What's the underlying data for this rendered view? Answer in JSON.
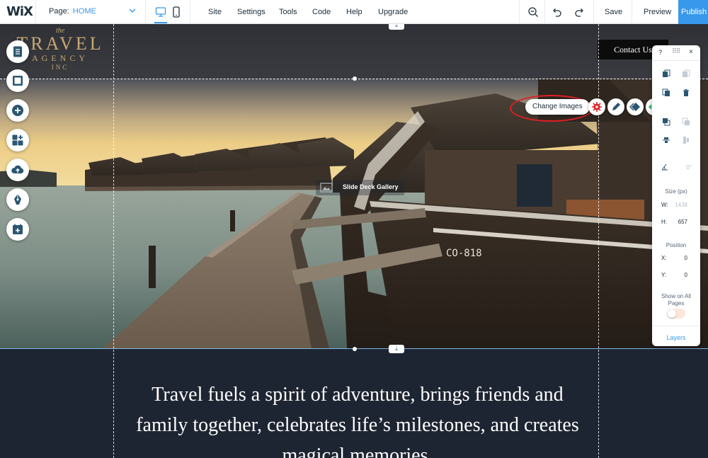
{
  "topbar": {
    "logo": "WiX",
    "page_label": "Page:",
    "page_name": "HOME",
    "menu": [
      "Site",
      "Settings",
      "Tools",
      "Code",
      "Help",
      "Upgrade"
    ],
    "save": "Save",
    "preview": "Preview",
    "publish": "Publish",
    "accent": "#3899ec"
  },
  "site": {
    "brand_the": "the",
    "brand_name": "TRAVEL",
    "brand_agency": "AGENCY",
    "brand_inc": "INC",
    "contact_button": "Contact Us",
    "boat_number": "CO-818",
    "quote": "Travel fuels a spirit of adventure, brings friends and family together, celebrates life’s milestones, and creates magical memories."
  },
  "gallery": {
    "label": "Slide Deck Gallery",
    "change_images": "Change Images",
    "tools": [
      "settings-icon",
      "design-pen-icon",
      "animation-icon",
      "stretch-icon",
      "help-icon"
    ]
  },
  "left_tools": [
    "pages-icon",
    "background-icon",
    "add-icon",
    "app-market-icon",
    "media-upload-icon",
    "blog-pen-icon",
    "bookings-icon"
  ],
  "panel": {
    "help": "?",
    "close": "×",
    "rotation": "0°",
    "size_title": "Size (px)",
    "w_label": "W:",
    "w_value": "1438",
    "h_label": "H:",
    "h_value": "657",
    "position_title": "Position",
    "x_label": "X:",
    "x_value": "0",
    "y_label": "Y:",
    "y_value": "0",
    "show_all_pages": "Show on All Pages",
    "show_all_pages_on": false,
    "layers": "Layers"
  }
}
